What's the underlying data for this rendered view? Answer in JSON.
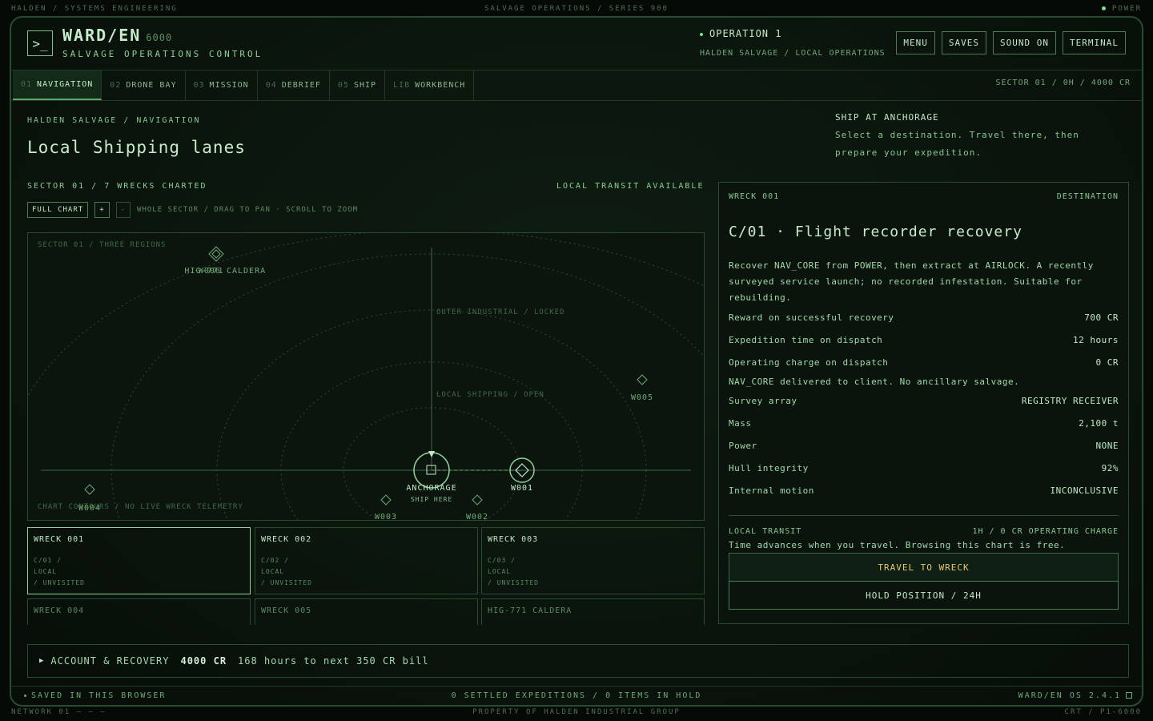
{
  "top_strip": {
    "left": "HALDEN / SYSTEMS ENGINEERING",
    "center": "SALVAGE OPERATIONS / SERIES 900",
    "right": "POWER"
  },
  "bottom_strip": {
    "left": "NETWORK 01 — — —",
    "center": "PROPERTY OF HALDEN INDUSTRIAL GROUP",
    "right": "CRT / P1-6000"
  },
  "header": {
    "logo_glyph": ">_",
    "brand": "WARD/EN",
    "brand_num": "6000",
    "subtitle": "SALVAGE OPERATIONS CONTROL",
    "operation": "OPERATION 1",
    "operation_sub": "HALDEN SALVAGE / LOCAL OPERATIONS",
    "buttons": {
      "menu": "MENU",
      "saves": "SAVES",
      "sound": "SOUND ON",
      "terminal": "TERMINAL"
    }
  },
  "tabs": [
    {
      "num": "01",
      "label": "NAVIGATION"
    },
    {
      "num": "02",
      "label": "DRONE BAY"
    },
    {
      "num": "03",
      "label": "MISSION"
    },
    {
      "num": "04",
      "label": "DEBRIEF"
    },
    {
      "num": "05",
      "label": "SHIP"
    },
    {
      "num": "LIB",
      "label": "WORKBENCH"
    }
  ],
  "tabs_status": "SECTOR 01 / 0H / 4000 CR",
  "page": {
    "breadcrumb": "HALDEN SALVAGE / NAVIGATION",
    "title": "Local Shipping lanes",
    "anchor_title": "SHIP AT ANCHORAGE",
    "anchor_text": "Select a destination. Travel there, then prepare your expedition."
  },
  "chart": {
    "sector_line": "SECTOR 01 / 7 WRECKS CHARTED",
    "transit_available": "LOCAL TRANSIT AVAILABLE",
    "full_chart": "FULL CHART",
    "zoom_in": "+",
    "zoom_out": "-",
    "hint": "WHOLE SECTOR / DRAG TO PAN · SCROLL TO ZOOM",
    "region_label": "SECTOR 01 / THREE REGIONS",
    "outer_label": "OUTER INDUSTRIAL / LOCKED",
    "local_label": "LOCAL SHIPPING / OPEN",
    "footer_label": "CHART CONTOURS / NO LIVE WRECK TELEMETRY",
    "nodes": {
      "caldera_a": "HIG-771",
      "caldera_b": "W006 CALDERA",
      "w005": "W005",
      "w004": "W004",
      "w003": "W003",
      "w002": "W002",
      "w001": "W001",
      "anchorage": "ANCHORAGE",
      "anchorage_sub": "SHIP HERE"
    }
  },
  "cards": [
    {
      "title": "WRECK 001",
      "code": "C/01 /",
      "zone": "LOCAL",
      "status": "/ UNVISITED"
    },
    {
      "title": "WRECK 002",
      "code": "C/02 /",
      "zone": "LOCAL",
      "status": "/ UNVISITED"
    },
    {
      "title": "WRECK 003",
      "code": "C/03 /",
      "zone": "LOCAL",
      "status": "/ UNVISITED"
    },
    {
      "title": "WRECK 004"
    },
    {
      "title": "WRECK 005"
    },
    {
      "title": "HIG-771 CALDERA"
    }
  ],
  "panel": {
    "head_left": "WRECK 001",
    "head_right": "DESTINATION",
    "title": "C/01 · Flight recorder recovery",
    "description": "Recover NAV_CORE from POWER, then extract at AIRLOCK. A recently surveyed service launch; no recorded infestation. Suitable for rebuilding.",
    "rows_a": [
      {
        "label": "Reward on successful recovery",
        "value": "700 CR"
      },
      {
        "label": "Expedition time on dispatch",
        "value": "12 hours"
      },
      {
        "label": "Operating charge on dispatch",
        "value": "0 CR"
      }
    ],
    "note": "NAV_CORE delivered to client. No ancillary salvage.",
    "rows_b": [
      {
        "label": "Survey array",
        "value": "REGISTRY RECEIVER"
      },
      {
        "label": "Mass",
        "value": "2,100 t"
      },
      {
        "label": "Power",
        "value": "NONE"
      },
      {
        "label": "Hull integrity",
        "value": "92%"
      },
      {
        "label": "Internal motion",
        "value": "INCONCLUSIVE"
      }
    ],
    "transit_label": "LOCAL TRANSIT",
    "transit_cost": "1H / 0 CR OPERATING CHARGE",
    "transit_text": "Time advances when you travel. Browsing this chart is free.",
    "travel_button": "TRAVEL TO WRECK",
    "hold_button": "HOLD POSITION / 24H"
  },
  "account": {
    "label": "ACCOUNT & RECOVERY",
    "credits": "4000 CR",
    "bill": "168 hours to next 350 CR bill"
  },
  "footer": {
    "left": "SAVED IN THIS BROWSER",
    "center": "0 SETTLED EXPEDITIONS / 0 ITEMS IN HOLD",
    "right": "WARD/EN OS 2.4.1"
  }
}
